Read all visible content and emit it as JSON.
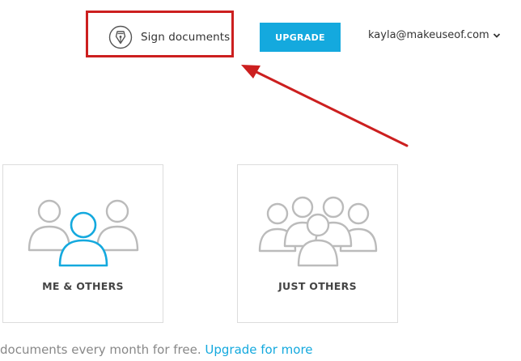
{
  "header": {
    "sign_documents_label": "Sign documents",
    "upgrade_label": "UPGRADE",
    "account_email": "kayla@makeuseof.com"
  },
  "options": [
    {
      "label": "ME & OTHERS"
    },
    {
      "label": "JUST OTHERS"
    }
  ],
  "footer": {
    "text": "documents every month for free. ",
    "link": "Upgrade for more"
  },
  "colors": {
    "accent": "#14a9de",
    "annotation": "#cc1f1f",
    "icon_gray": "#bbbbbb"
  },
  "icons": {
    "sign": "pen-nib-icon",
    "account_menu": "chevron-down-icon",
    "option_me_others": "people-group-highlighted-icon",
    "option_just_others": "people-group-icon"
  }
}
